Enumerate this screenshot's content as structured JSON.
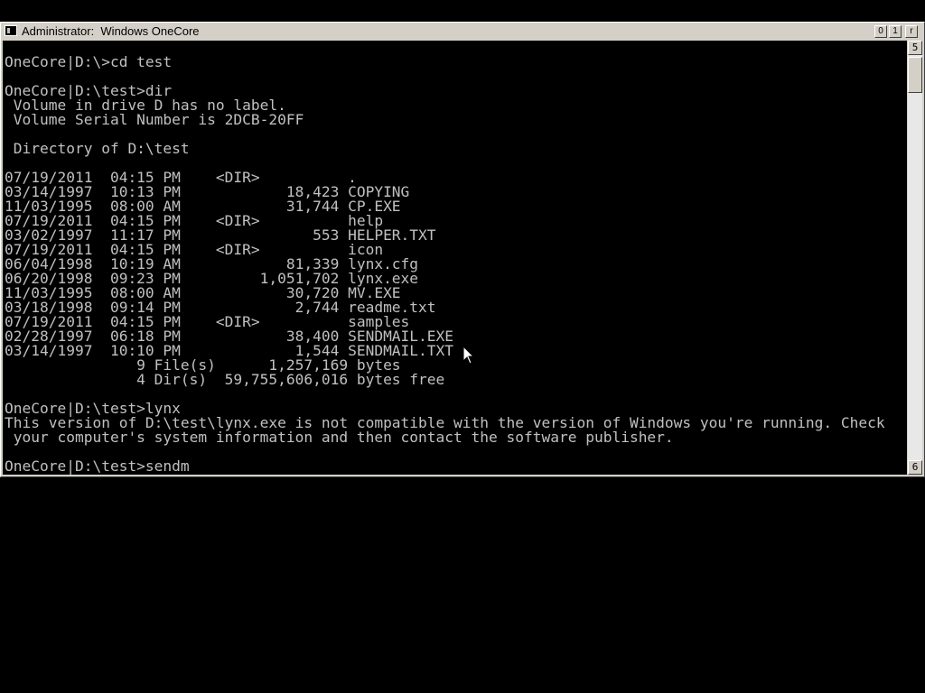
{
  "window": {
    "title": "Administrator:  Windows OneCore",
    "buttons": {
      "minimize": "0",
      "maximize": "1",
      "close": "r"
    }
  },
  "scrollbar": {
    "up_glyph": "5",
    "down_glyph": "6"
  },
  "console": {
    "lines": [
      "OneCore|D:\\>cd test",
      "",
      "OneCore|D:\\test>dir",
      " Volume in drive D has no label.",
      " Volume Serial Number is 2DCB-20FF",
      "",
      " Directory of D:\\test",
      "",
      "07/19/2011  04:15 PM    <DIR>          .",
      "03/14/1997  10:13 PM            18,423 COPYING",
      "11/03/1995  08:00 AM            31,744 CP.EXE",
      "07/19/2011  04:15 PM    <DIR>          help",
      "03/02/1997  11:17 PM               553 HELPER.TXT",
      "07/19/2011  04:15 PM    <DIR>          icon",
      "06/04/1998  10:19 AM            81,339 lynx.cfg",
      "06/20/1998  09:23 PM         1,051,702 lynx.exe",
      "11/03/1995  08:00 AM            30,720 MV.EXE",
      "03/18/1998  09:14 PM             2,744 readme.txt",
      "07/19/2011  04:15 PM    <DIR>          samples",
      "02/28/1997  06:18 PM            38,400 SENDMAIL.EXE",
      "03/14/1997  10:10 PM             1,544 SENDMAIL.TXT",
      "               9 File(s)      1,257,169 bytes",
      "               4 Dir(s)  59,755,606,016 bytes free",
      "",
      "OneCore|D:\\test>lynx",
      "This version of D:\\test\\lynx.exe is not compatible with the version of Windows you're running. Check",
      " your computer's system information and then contact the software publisher.",
      "",
      "OneCore|D:\\test>sendm"
    ]
  },
  "colors": {
    "console_background": "#000000",
    "console_foreground": "#c0c0c0",
    "window_chrome": "#d4d0c8"
  }
}
